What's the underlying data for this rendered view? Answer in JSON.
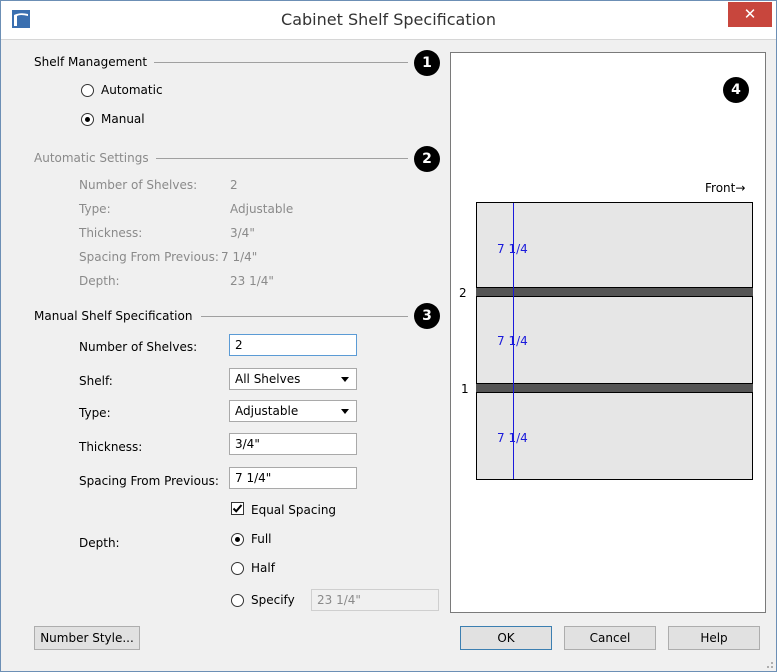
{
  "window": {
    "title": "Cabinet Shelf Specification",
    "close_glyph": "✕"
  },
  "badges": [
    "1",
    "2",
    "3",
    "4"
  ],
  "shelf_management": {
    "title": "Shelf Management",
    "automatic_label": "Automatic",
    "manual_label": "Manual",
    "selected": "Manual"
  },
  "automatic_settings": {
    "title": "Automatic Settings",
    "rows": [
      {
        "label": "Number of Shelves:",
        "value": "2"
      },
      {
        "label": "Type:",
        "value": "Adjustable"
      },
      {
        "label": "Thickness:",
        "value": "3/4\""
      },
      {
        "label": "Spacing From Previous:",
        "value": "7 1/4\""
      },
      {
        "label": "Depth:",
        "value": "23 1/4\""
      }
    ]
  },
  "manual_spec": {
    "title": "Manual Shelf Specification",
    "number_of_shelves_label": "Number of Shelves:",
    "number_of_shelves_value": "2",
    "shelf_label": "Shelf:",
    "shelf_value": "All Shelves",
    "type_label": "Type:",
    "type_value": "Adjustable",
    "thickness_label": "Thickness:",
    "thickness_value": "3/4\"",
    "spacing_label": "Spacing From Previous:",
    "spacing_value": "7 1/4\"",
    "equal_spacing_label": "Equal Spacing",
    "equal_spacing_checked": true,
    "depth_label": "Depth:",
    "depth_full_label": "Full",
    "depth_half_label": "Half",
    "depth_specify_label": "Specify",
    "depth_specify_value": "23 1/4\"",
    "depth_selected": "Full"
  },
  "preview": {
    "front_label": "Front",
    "arrow_glyph": "→",
    "shelf_numbers": [
      "2",
      "1"
    ],
    "spacing_labels": [
      "7 1/4",
      "7 1/4",
      "7 1/4"
    ],
    "spacing_color": "#1a1adb"
  },
  "buttons": {
    "number_style": "Number Style...",
    "ok": "OK",
    "cancel": "Cancel",
    "help": "Help"
  },
  "colors": {
    "close_button": "#c8463d",
    "title_icon": "#3a6fb0",
    "focus_border": "#5b9bd5"
  }
}
